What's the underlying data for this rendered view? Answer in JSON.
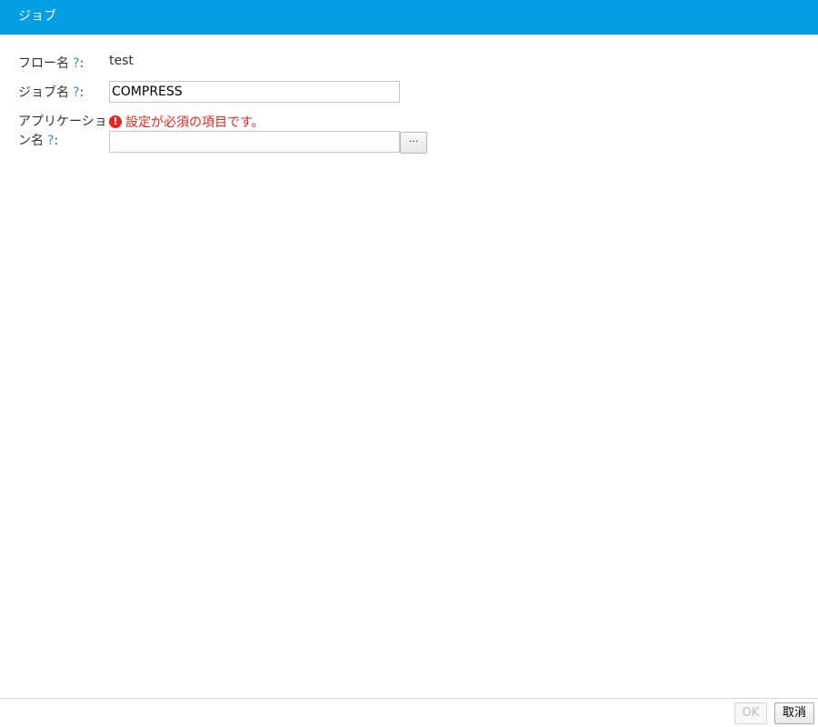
{
  "window": {
    "title": "ジョブ"
  },
  "form": {
    "help_mark": "?",
    "colon": ":",
    "flow_name": {
      "label": "フロー名",
      "value": "test"
    },
    "job_name": {
      "label": "ジョブ名",
      "value": "COMPRESS"
    },
    "application_name": {
      "label_line1": "アプリケーショ",
      "label_line2": "ン名",
      "value": "",
      "error_icon": "!",
      "error_text": "設定が必須の項目です。",
      "browse_label": "···"
    }
  },
  "footer": {
    "ok_label": "OK",
    "cancel_label": "取消"
  },
  "colors": {
    "title_bar": "#039fe3",
    "error": "#e8251e",
    "help_link": "#3a8fc7"
  }
}
